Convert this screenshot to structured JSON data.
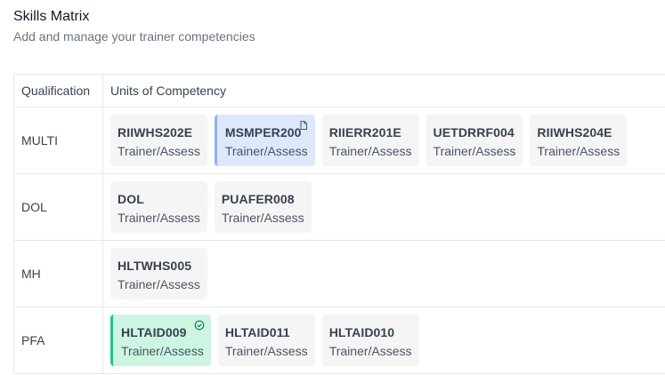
{
  "page": {
    "title": "Skills Matrix",
    "subtitle": "Add and manage your trainer competencies"
  },
  "table": {
    "headers": {
      "qualification": "Qualification",
      "units": "Units of Competency"
    },
    "rows": [
      {
        "qualification": "MULTI",
        "units": [
          {
            "code": "RIIWHS202E",
            "role": "Trainer/Assess",
            "state": "default"
          },
          {
            "code": "MSMPER200",
            "role": "Trainer/Assess",
            "state": "selected",
            "icon": "document-icon"
          },
          {
            "code": "RIIERR201E",
            "role": "Trainer/Assess",
            "state": "default"
          },
          {
            "code": "UETDRRF004",
            "role": "Trainer/Assess",
            "state": "default"
          },
          {
            "code": "RIIWHS204E",
            "role": "Trainer/Assess",
            "state": "default"
          }
        ]
      },
      {
        "qualification": "DOL",
        "units": [
          {
            "code": "DOL",
            "role": "Trainer/Assess",
            "state": "default"
          },
          {
            "code": "PUAFER008",
            "role": "Trainer/Assess",
            "state": "default"
          }
        ]
      },
      {
        "qualification": "MH",
        "units": [
          {
            "code": "HLTWHS005",
            "role": "Trainer/Assess",
            "state": "default"
          }
        ]
      },
      {
        "qualification": "PFA",
        "units": [
          {
            "code": "HLTAID009",
            "role": "Trainer/Assess",
            "state": "complete",
            "icon": "check-circle-icon"
          },
          {
            "code": "HLTAID011",
            "role": "Trainer/Assess",
            "state": "default"
          },
          {
            "code": "HLTAID010",
            "role": "Trainer/Assess",
            "state": "default"
          }
        ]
      }
    ]
  },
  "colors": {
    "selected_bg": "#dde9fb",
    "selected_accent": "#8fb3ee",
    "complete_bg": "#ccf5e2",
    "complete_accent": "#22c58a"
  }
}
